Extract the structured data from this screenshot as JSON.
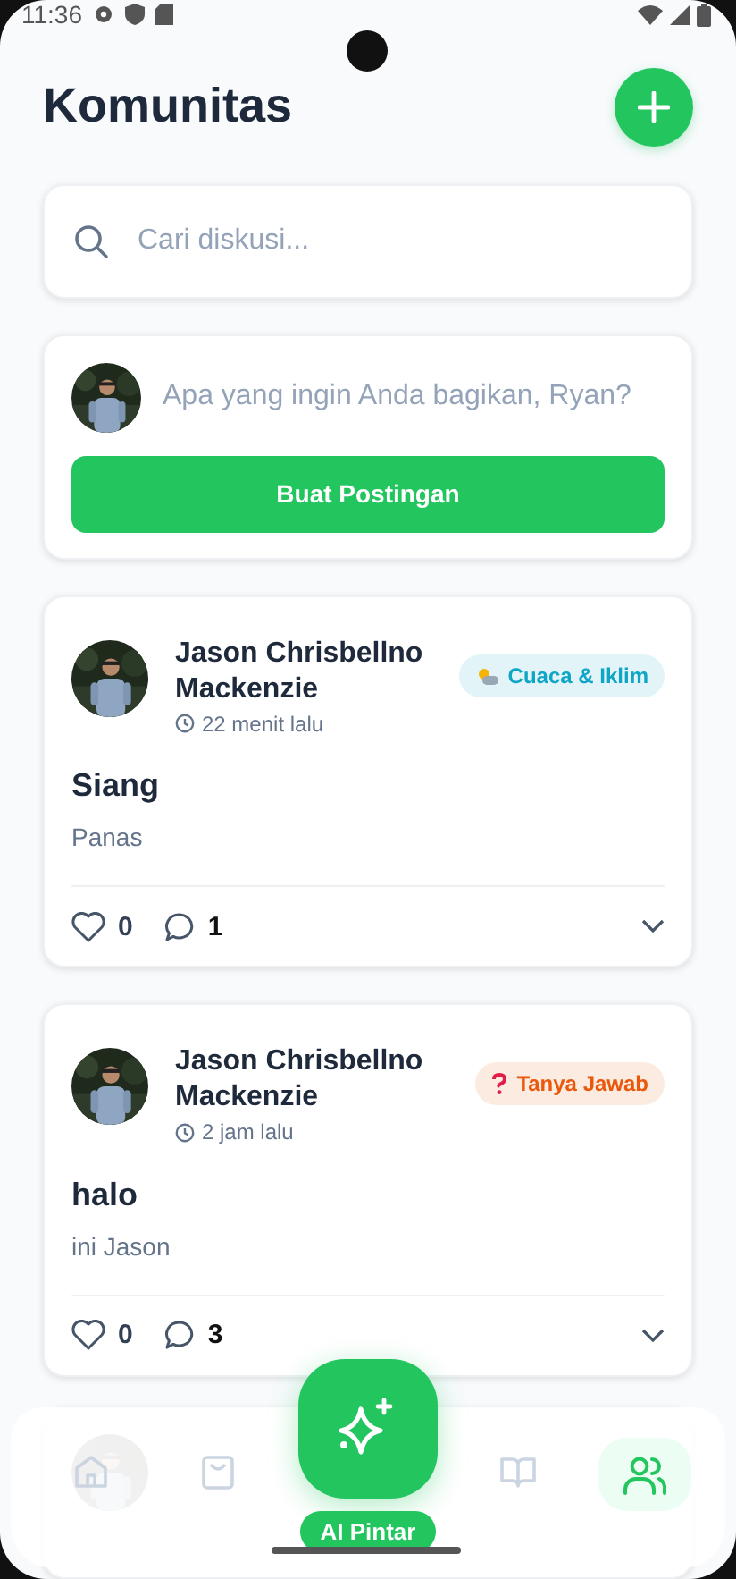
{
  "status_bar": {
    "time": "11:36"
  },
  "header": {
    "title": "Komunitas"
  },
  "search": {
    "placeholder": "Cari diskusi..."
  },
  "composer": {
    "placeholder": "Apa yang ingin Anda bagikan, Ryan?",
    "button": "Buat Postingan"
  },
  "posts": [
    {
      "author": "Jason Chrisbellno Mackenzie",
      "time": "22 menit lalu",
      "category": "Cuaca & Iklim",
      "kind": "weather",
      "color": "#0ea5c6",
      "title": "Siang",
      "body": "Panas",
      "likes": "0",
      "comments": "1",
      "liked": false
    },
    {
      "author": "Jason Chrisbellno Mackenzie",
      "time": "2 jam lalu",
      "category": "Tanya Jawab",
      "kind": "question",
      "color": "#ea580c",
      "title": "halo",
      "body": "ini Jason",
      "likes": "0",
      "comments": "3",
      "liked": false
    }
  ],
  "bottom_nav": {
    "items": [
      {
        "kind": "home",
        "selected": false
      },
      {
        "kind": "bag",
        "selected": false
      },
      {
        "kind": "ai",
        "selected": false,
        "label": "AI Pintar"
      },
      {
        "kind": "book",
        "selected": false
      },
      {
        "kind": "people",
        "selected": true
      }
    ]
  }
}
